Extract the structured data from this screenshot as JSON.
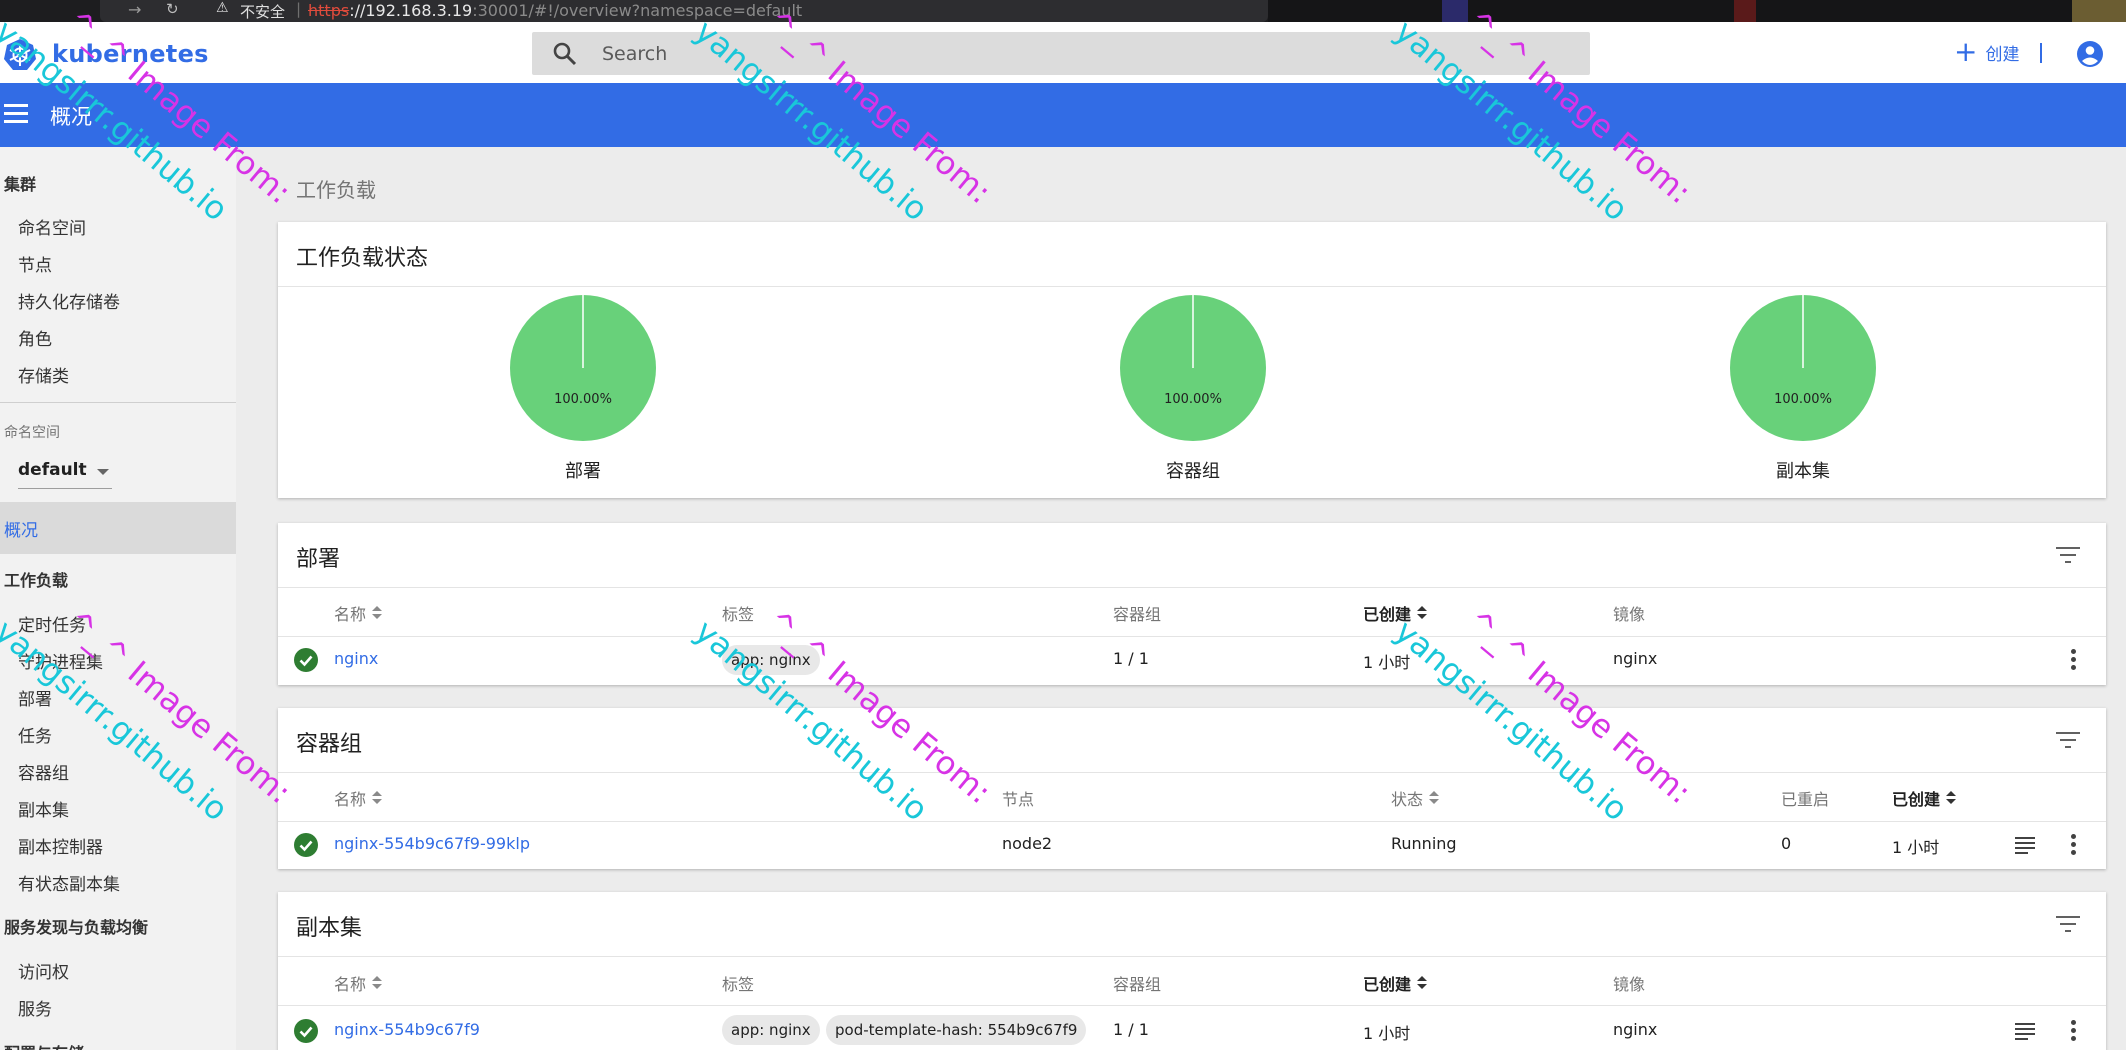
{
  "browser": {
    "insecure_label": "不安全",
    "url_scheme": "https",
    "url_host": "://192.168.3.19",
    "url_rest": ":30001/#!/overview?namespace=default"
  },
  "header": {
    "logo_text": "kubernetes",
    "search_placeholder": "Search",
    "create_label": "创建"
  },
  "titlebar": {
    "title": "概况"
  },
  "sidebar": {
    "cluster_heading": "集群",
    "cluster_items": [
      "命名空间",
      "节点",
      "持久化存储卷",
      "角色",
      "存储类"
    ],
    "namespace_label": "命名空间",
    "namespace_value": "default",
    "overview_label": "概况",
    "workloads_heading": "工作负载",
    "workload_items": [
      "定时任务",
      "守护进程集",
      "部署",
      "任务",
      "容器组",
      "副本集",
      "副本控制器",
      "有状态副本集"
    ],
    "discovery_heading": "服务发现与负载均衡",
    "discovery_items": [
      "访问权",
      "服务"
    ],
    "config_heading": "配置与存储"
  },
  "page": {
    "heading": "工作负载"
  },
  "status_card": {
    "title": "工作负载状态",
    "charts": [
      {
        "label": "部署",
        "percent_text": "100.00%",
        "running_fraction": 1.0
      },
      {
        "label": "容器组",
        "percent_text": "100.00%",
        "running_fraction": 1.0
      },
      {
        "label": "副本集",
        "percent_text": "100.00%",
        "running_fraction": 1.0
      }
    ],
    "color_running": "#68d17a"
  },
  "deployments": {
    "title": "部署",
    "headers": {
      "name": "名称",
      "labels": "标签",
      "pods": "容器组",
      "created": "已创建",
      "image": "镜像"
    },
    "rows": [
      {
        "name": "nginx",
        "label": "app: nginx",
        "pods": "1 / 1",
        "created": "1 小时",
        "image": "nginx"
      }
    ]
  },
  "pods": {
    "title": "容器组",
    "headers": {
      "name": "名称",
      "node": "节点",
      "status": "状态",
      "restarts": "已重启",
      "created": "已创建"
    },
    "rows": [
      {
        "name": "nginx-554b9c67f9-99klp",
        "node": "node2",
        "status": "Running",
        "restarts": "0",
        "created": "1 小时"
      }
    ]
  },
  "replicasets": {
    "title": "副本集",
    "headers": {
      "name": "名称",
      "labels": "标签",
      "pods": "容器组",
      "created": "已创建",
      "image": "镜像"
    },
    "rows": [
      {
        "name": "nginx-554b9c67f9",
        "label1": "app: nginx",
        "label2": "pod-template-hash: 554b9c67f9",
        "pods": "1 / 1",
        "created": "1 小时",
        "image": "nginx"
      }
    ]
  },
  "watermark": {
    "line1": "yangsirrr.github.io",
    "line2": "^_^ Image From:"
  },
  "colors": {
    "accent": "#326ce5",
    "success": "#2e7d32"
  }
}
